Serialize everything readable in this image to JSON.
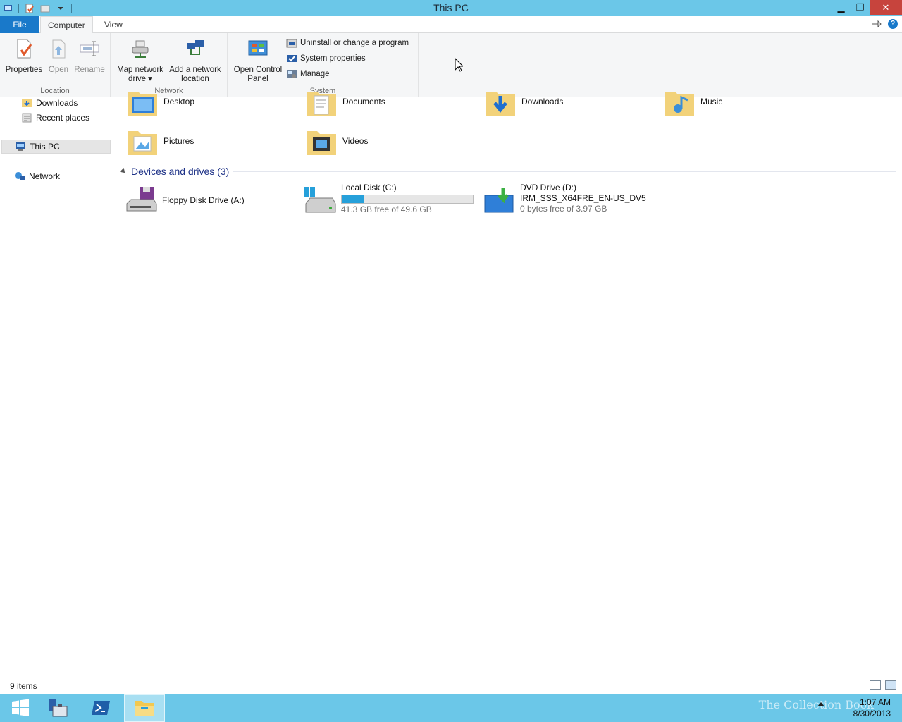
{
  "window": {
    "title": "This PC"
  },
  "titlebar": {
    "minimize": "▁",
    "restore": "❐",
    "close": "✕"
  },
  "tabs": {
    "file": "File",
    "computer": "Computer",
    "view": "View"
  },
  "ribbon": {
    "location": {
      "label": "Location",
      "properties": "Properties",
      "open": "Open",
      "rename": "Rename"
    },
    "network": {
      "label": "Network",
      "map_line1": "Map network",
      "map_line2": "drive ▾",
      "add_line1": "Add a network",
      "add_line2": "location"
    },
    "system": {
      "label": "System",
      "control_line1": "Open Control",
      "control_line2": "Panel",
      "uninstall": "Uninstall or change a program",
      "sysprops": "System properties",
      "manage": "Manage"
    }
  },
  "nav": {
    "downloads": "Downloads",
    "recent": "Recent places",
    "thispc": "This PC",
    "network": "Network"
  },
  "folders": {
    "desktop": "Desktop",
    "documents": "Documents",
    "downloads": "Downloads",
    "music": "Music",
    "pictures": "Pictures",
    "videos": "Videos"
  },
  "devices": {
    "header": "Devices and drives (3)",
    "floppy": "Floppy Disk Drive (A:)",
    "local": {
      "name": "Local Disk (C:)",
      "free": "41.3 GB free of 49.6 GB",
      "used_fraction": 0.167
    },
    "dvd": {
      "name": "DVD Drive (D:)",
      "label": "IRM_SSS_X64FRE_EN-US_DV5",
      "free": "0 bytes free of 3.97 GB"
    }
  },
  "status": {
    "count": "9 items"
  },
  "taskbar": {
    "time": "1:07 AM",
    "date": "8/30/2013",
    "watermark": "The Collection Book"
  },
  "colors": {
    "titlebar": "#6bc7e8",
    "file_tab": "#1979ca",
    "drive_bar": "#26a0da"
  }
}
